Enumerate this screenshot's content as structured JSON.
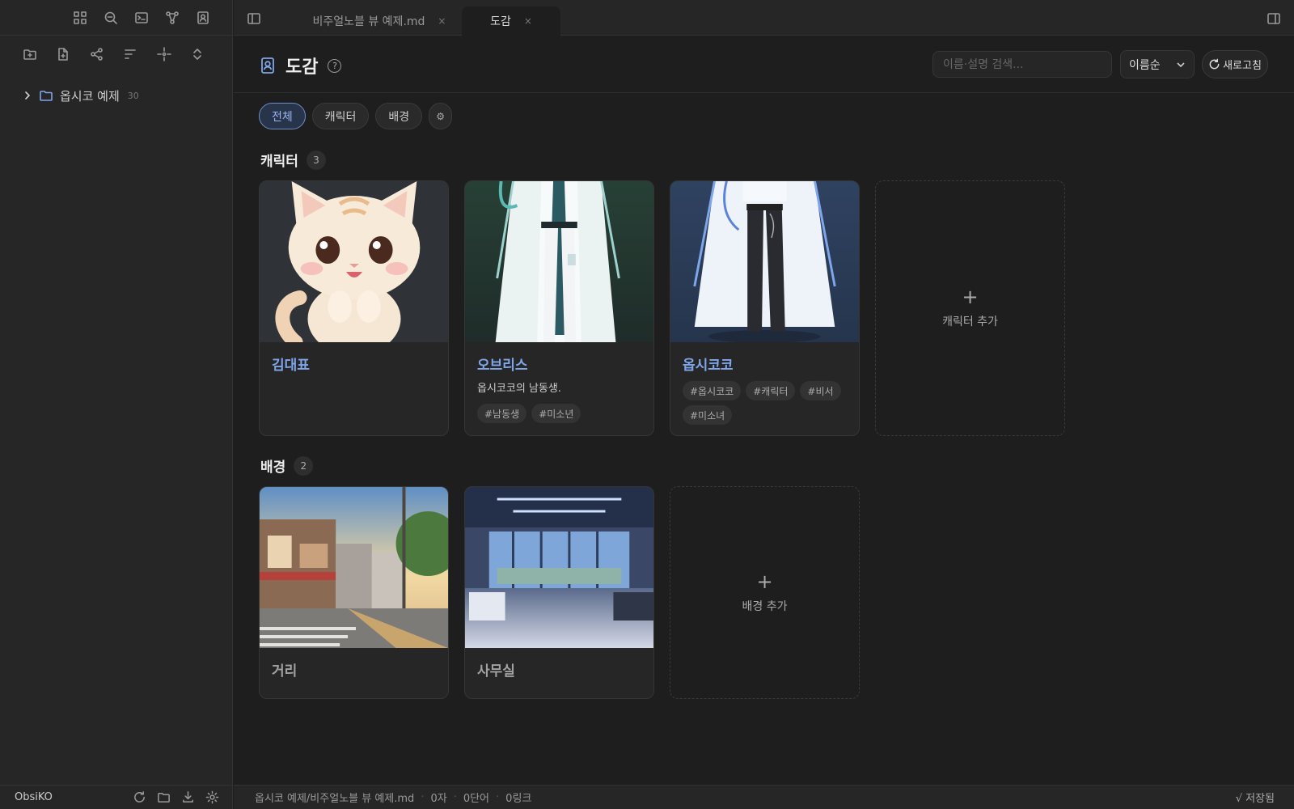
{
  "sidebar": {
    "top_icons": [
      "grid-icon",
      "search-icon",
      "terminal-icon",
      "graph-icon",
      "contact-icon"
    ],
    "tool_icons": [
      "new-folder-icon",
      "new-file-icon",
      "graph-icon",
      "sort-icon",
      "locate-icon",
      "expand-collapse-icon"
    ],
    "tree": [
      {
        "label": "옵시코 예제",
        "count": "30"
      }
    ],
    "vault_name": "ObsiKO"
  },
  "tabs": [
    {
      "label": "비주얼노블 뷰 예제.md",
      "close": "×",
      "active": false
    },
    {
      "label": "도감",
      "close": "×",
      "active": true
    }
  ],
  "header": {
    "title": "도감",
    "help": "?",
    "search_placeholder": "이름·설명 검색...",
    "sort_value": "이름순",
    "refresh_label": "새로고침"
  },
  "filters": {
    "all": "전체",
    "character": "캐릭터",
    "background": "배경",
    "settings": "⚙"
  },
  "sections": {
    "characters": {
      "title": "캐릭터",
      "count": "3",
      "items": [
        {
          "name": "김대표",
          "desc": "",
          "tags": []
        },
        {
          "name": "오브리스",
          "desc": "옵시코코의 남동생.",
          "tags": [
            "#남동생",
            "#미소년"
          ]
        },
        {
          "name": "옵시코코",
          "desc": "",
          "tags": [
            "#옵시코코",
            "#캐릭터",
            "#비서",
            "#미소녀"
          ]
        }
      ],
      "add_label": "캐릭터 추가"
    },
    "backgrounds": {
      "title": "배경",
      "count": "2",
      "items": [
        {
          "name": "거리"
        },
        {
          "name": "사무실"
        }
      ],
      "add_label": "배경 추가"
    }
  },
  "statusbar": {
    "path": "옵시코 예제/비주얼노블 뷰 예제.md",
    "chars": "0자",
    "words": "0단어",
    "links": "0링크",
    "saved": "√ 저장됨"
  },
  "colors": {
    "accent": "#7fa6ea",
    "background": "#1e1e1e",
    "panel": "#262626"
  }
}
